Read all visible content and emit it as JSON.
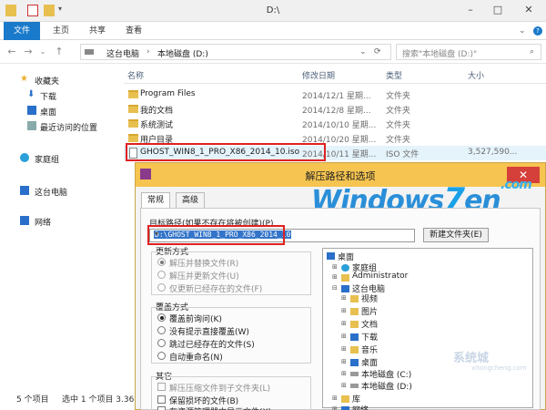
{
  "window": {
    "title": "D:\\"
  },
  "ribbon": {
    "tabs": [
      "文件",
      "主页",
      "共享",
      "查看"
    ]
  },
  "address": {
    "crumbs": [
      "这台电脑",
      "本地磁盘 (D:)"
    ],
    "search_placeholder": "搜索\"本地磁盘 (D:)\""
  },
  "nav": {
    "favorites_header": "收藏夹",
    "favorites": [
      "下载",
      "桌面",
      "最近访问的位置"
    ],
    "homegroup": "家庭组",
    "this_pc": "这台电脑",
    "network": "网络"
  },
  "columns": {
    "name": "名称",
    "date": "修改日期",
    "type": "类型",
    "size": "大小"
  },
  "files": [
    {
      "name": "Program Files",
      "date": "2014/12/1  星期...",
      "type": "文件夹",
      "size": ""
    },
    {
      "name": "我的文档",
      "date": "2014/12/8  星期...",
      "type": "文件夹",
      "size": ""
    },
    {
      "name": "系统测试",
      "date": "2014/10/10 星期...",
      "type": "文件夹",
      "size": ""
    },
    {
      "name": "用户目录",
      "date": "2014/10/20 星期...",
      "type": "文件夹",
      "size": ""
    },
    {
      "name": "GHOST_WIN8_1_PRO_X86_2014_10.iso",
      "date": "2014/10/11 星期...",
      "type": "ISO 文件",
      "size": "3,527,590..."
    }
  ],
  "status": {
    "count": "5 个项目",
    "selected": "选中 1 个项目  3.36"
  },
  "dialog": {
    "title": "解压路径和选项",
    "tabs": [
      "常规",
      "高级"
    ],
    "target_label": "目标路径(如果不存在将被创建)(P)",
    "target_value": "D:\\GHOST_WIN8_1_PRO_X86_2014_10",
    "new_folder": "新建文件夹(E)",
    "update_header": "更新方式",
    "update_options": [
      "解压并替换文件(R)",
      "解压并更新文件(U)",
      "仅更新已经存在的文件(F)"
    ],
    "overwrite_header": "覆盖方式",
    "overwrite_options": [
      "覆盖前询问(K)",
      "没有提示直接覆盖(W)",
      "跳过已经存在的文件(S)",
      "自动重命名(N)"
    ],
    "other_header": "其它",
    "other_options": [
      "解压压缩文件到子文件夹(L)",
      "保留损坏的文件(B)",
      "在资源管理器中显示文件(X)"
    ],
    "tree": [
      "桌面",
      "家庭组",
      "Administrator",
      "这台电脑",
      "视频",
      "图片",
      "文档",
      "下载",
      "音乐",
      "桌面",
      "本地磁盘 (C:)",
      "本地磁盘 (D:)",
      "库",
      "网络"
    ],
    "close": "✕"
  },
  "branding": {
    "logo_main": "Windows",
    "logo_seven": "7",
    "logo_en": "en",
    "logo_com": ".com",
    "watermark": "系统城",
    "watermark_sub": "xitongcheng.com"
  },
  "colors": {
    "accent": "#1979ca",
    "dialog_title": "#f6c450",
    "highlight": "#e02020"
  }
}
